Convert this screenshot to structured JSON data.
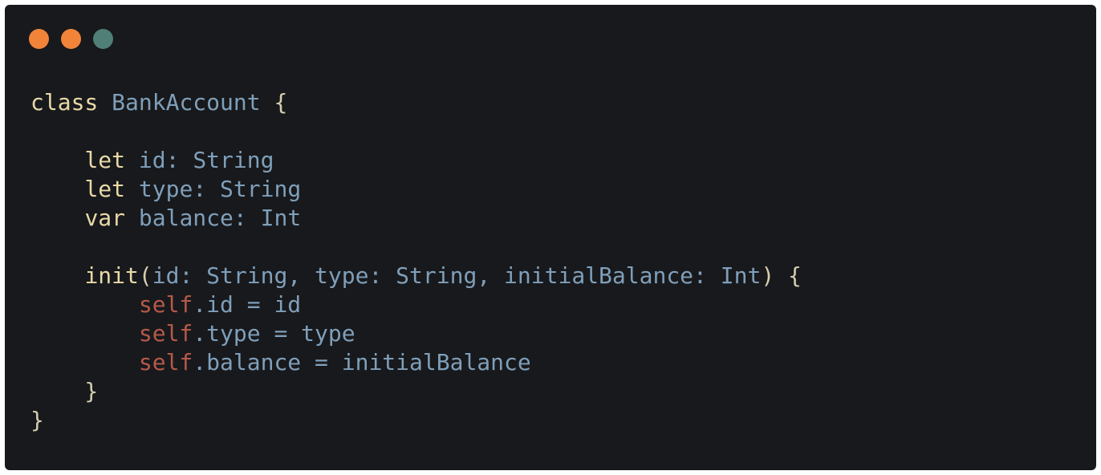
{
  "colors": {
    "window_bg": "#18191c",
    "keyword": "#e8d9a8",
    "identifier": "#7f9fba",
    "self": "#b5594a",
    "punctuation": "#d5cdb0",
    "dot_close": "#f2843a",
    "dot_minimize": "#f2843a",
    "dot_zoom": "#4f7f77"
  },
  "window_controls": [
    {
      "name": "close-dot",
      "color": "#f2843a"
    },
    {
      "name": "minimize-dot",
      "color": "#f2843a"
    },
    {
      "name": "zoom-dot",
      "color": "#4f7f77"
    }
  ],
  "code": {
    "language": "swift",
    "lines": [
      [
        {
          "t": "class",
          "k": "keyword"
        },
        {
          "t": " ",
          "k": "punctuation"
        },
        {
          "t": "BankAccount",
          "k": "identifier"
        },
        {
          "t": " {",
          "k": "punctuation"
        }
      ],
      [],
      [
        {
          "t": "    ",
          "k": "punctuation"
        },
        {
          "t": "let",
          "k": "keyword"
        },
        {
          "t": " ",
          "k": "punctuation"
        },
        {
          "t": "id",
          "k": "identifier"
        },
        {
          "t": ": ",
          "k": "identifier"
        },
        {
          "t": "String",
          "k": "identifier"
        }
      ],
      [
        {
          "t": "    ",
          "k": "punctuation"
        },
        {
          "t": "let",
          "k": "keyword"
        },
        {
          "t": " ",
          "k": "punctuation"
        },
        {
          "t": "type",
          "k": "identifier"
        },
        {
          "t": ": ",
          "k": "identifier"
        },
        {
          "t": "String",
          "k": "identifier"
        }
      ],
      [
        {
          "t": "    ",
          "k": "punctuation"
        },
        {
          "t": "var",
          "k": "keyword"
        },
        {
          "t": " ",
          "k": "punctuation"
        },
        {
          "t": "balance",
          "k": "identifier"
        },
        {
          "t": ": ",
          "k": "identifier"
        },
        {
          "t": "Int",
          "k": "identifier"
        }
      ],
      [],
      [
        {
          "t": "    ",
          "k": "punctuation"
        },
        {
          "t": "init",
          "k": "keyword"
        },
        {
          "t": "(",
          "k": "punctuation"
        },
        {
          "t": "id: String, type: String, initialBalance: Int",
          "k": "identifier"
        },
        {
          "t": ") {",
          "k": "punctuation"
        }
      ],
      [
        {
          "t": "        ",
          "k": "punctuation"
        },
        {
          "t": "self",
          "k": "self"
        },
        {
          "t": ".id = id",
          "k": "identifier"
        }
      ],
      [
        {
          "t": "        ",
          "k": "punctuation"
        },
        {
          "t": "self",
          "k": "self"
        },
        {
          "t": ".type = type",
          "k": "identifier"
        }
      ],
      [
        {
          "t": "        ",
          "k": "punctuation"
        },
        {
          "t": "self",
          "k": "self"
        },
        {
          "t": ".balance = initialBalance",
          "k": "identifier"
        }
      ],
      [
        {
          "t": "    }",
          "k": "punctuation"
        }
      ],
      [
        {
          "t": "}",
          "k": "punctuation"
        }
      ]
    ]
  }
}
